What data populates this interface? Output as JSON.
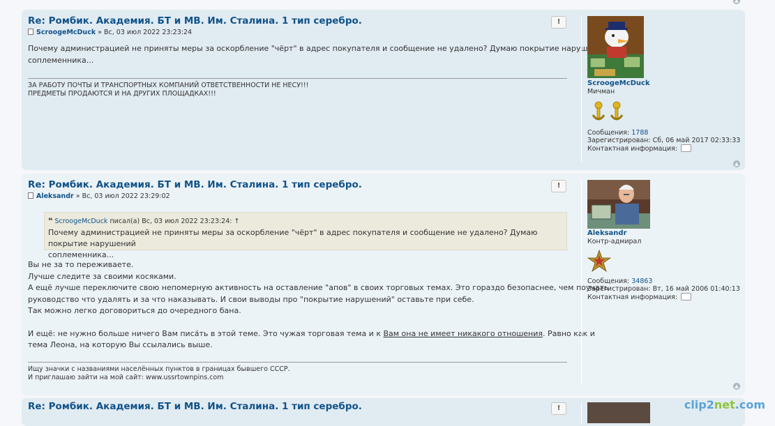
{
  "posts": [
    {
      "title": "Re: Ромбик. Академия. БТ и МВ. Им. Сталина. 1 тип серебро.",
      "author": "ScroogeMcDuck",
      "meta_sep": "»",
      "date": "Вс, 03 июл 2022 23:23:24",
      "report_label": "!",
      "body": [
        "Почему администрацией не приняты меры за оскорбление \"чёрт\" в адрес покупателя и сообщение не удалено? Думаю покрытие нарушений",
        "соплеменника..."
      ],
      "signature": [
        "ЗА РАБОТУ ПОЧТЫ И ТРАНСПОРТНЫХ КОМПАНИЙ ОТВЕТСТВЕННОСТИ НЕ НЕСУ!!!",
        "ПРЕДМЕТЫ ПРОДАЮТСЯ И НА ДРУГИХ ПЛОЩАДКАХ!!!"
      ],
      "profile": {
        "name": "ScroogeMcDuck",
        "rank": "Мичман",
        "messages_label": "Сообщения:",
        "messages": "1788",
        "registered_label": "Зарегистрирован:",
        "registered": "Сб, 06 май 2017 02:33:33",
        "contact_label": "Контактная информация:"
      }
    },
    {
      "title": "Re: Ромбик. Академия. БТ и МВ. Им. Сталина. 1 тип серебро.",
      "author": "Aleksandr",
      "meta_sep": "»",
      "date": "Вс, 03 июл 2022 23:29:02",
      "report_label": "!",
      "quote": {
        "mark": "❝",
        "author": "ScroogeMcDuck",
        "wrote": "писал(а) Вс, 03 июл 2022 23:23:24: ↑",
        "lines": [
          "Почему администрацией не приняты меры за оскорбление \"чёрт\" в адрес покупателя и сообщение не удалено? Думаю покрытие нарушений",
          "соплеменника..."
        ]
      },
      "body": [
        "Вы не за то переживаете.",
        "Лучше следите за своими косяками.",
        "А ещё лучше переключите свою непомерную активность на оставление \"апов\" в своих торговых темах. Это гораздо безопаснее, чем поучать",
        "руководство что удалять и за что наказывать. И свои выводы про \"покрытие нарушений\" оставьте при себе.",
        "Так можно легко договориться до очередного бана."
      ],
      "body2_pre": "И ещё: не нужно больше ничего Вам писа́ть в этой теме. Это чужая торговая тема и к ",
      "body2_link": "Вам она не имеет никакого отношения",
      "body2_post": ". Равно как и",
      "body2_line2": "тема Леона, на которую Вы ссылались выше.",
      "signature": [
        "Ищу значки с названиями населённых пунктов в границах бывшего СССР.",
        "И приглашаю зайти на мой сайт: www.ussrtownpins.com"
      ],
      "profile": {
        "name": "Aleksandr",
        "rank": "Контр-адмирал",
        "messages_label": "Сообщения:",
        "messages": "34863",
        "registered_label": "Зарегистрирован:",
        "registered": "Вт, 16 май 2006 01:40:13",
        "contact_label": "Контактная информация:"
      }
    },
    {
      "title": "Re: Ромбик. Академия. БТ и МВ. Им. Сталина. 1 тип серебро.",
      "report_label": "!"
    }
  ],
  "top_icon": "arrow-up-icon",
  "watermark": {
    "a": "clip2",
    "b": "net",
    "c": ".com"
  }
}
